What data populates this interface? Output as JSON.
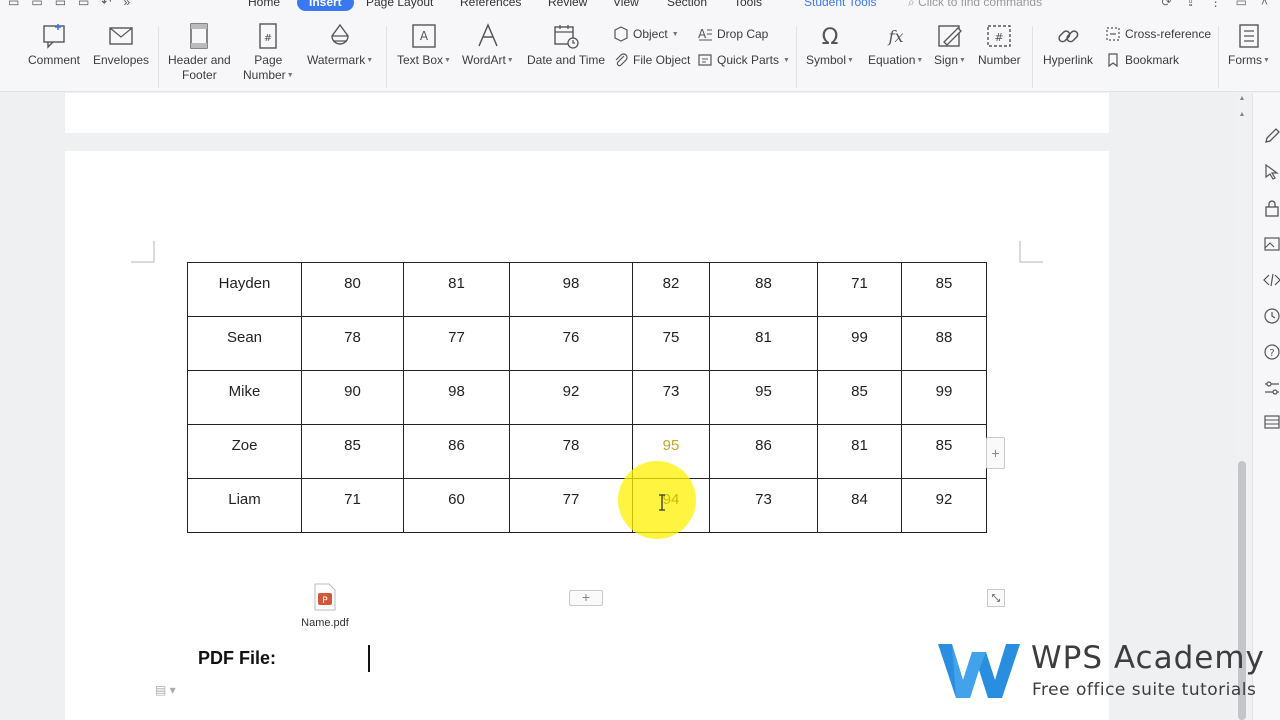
{
  "menubar": {
    "tabs": [
      "Home",
      "Insert",
      "Page Layout",
      "References",
      "Review",
      "View",
      "Section",
      "Tools"
    ],
    "student_tools": "Student Tools",
    "find_placeholder": "Click to find commands"
  },
  "ribbon": {
    "comment": "Comment",
    "envelopes": "Envelopes",
    "header_footer_1": "Header and",
    "header_footer_2": "Footer",
    "page_number_1": "Page",
    "page_number_2": "Number",
    "watermark": "Watermark",
    "text_box": "Text Box",
    "wordart": "WordArt",
    "date_time": "Date and Time",
    "object": "Object",
    "file_object": "File Object",
    "drop_cap": "Drop Cap",
    "quick_parts": "Quick Parts",
    "symbol": "Symbol",
    "equation": "Equation",
    "sign": "Sign",
    "number": "Number",
    "hyperlink": "Hyperlink",
    "cross_reference": "Cross-reference",
    "bookmark": "Bookmark",
    "forms": "Forms"
  },
  "table": {
    "rows": [
      {
        "name": "Hayden",
        "scores": [
          "80",
          "81",
          "98",
          "82",
          "88",
          "71",
          "85"
        ]
      },
      {
        "name": "Sean",
        "scores": [
          "78",
          "77",
          "76",
          "75",
          "81",
          "99",
          "88"
        ]
      },
      {
        "name": "Mike",
        "scores": [
          "90",
          "98",
          "92",
          "73",
          "95",
          "85",
          "99"
        ]
      },
      {
        "name": "Zoe",
        "scores": [
          "85",
          "86",
          "78",
          "95",
          "86",
          "81",
          "85"
        ]
      },
      {
        "name": "Liam",
        "scores": [
          "71",
          "60",
          "77",
          "94",
          "73",
          "84",
          "92"
        ]
      }
    ]
  },
  "attachment": {
    "filename": "Name.pdf"
  },
  "document": {
    "pdf_label": "PDF File:"
  },
  "watermark": {
    "title": "WPS Academy",
    "tagline": "Free office suite tutorials"
  },
  "colors": {
    "accent": "#3a78f2",
    "highlight": "#fff000",
    "logo": "#2a8ee0"
  }
}
